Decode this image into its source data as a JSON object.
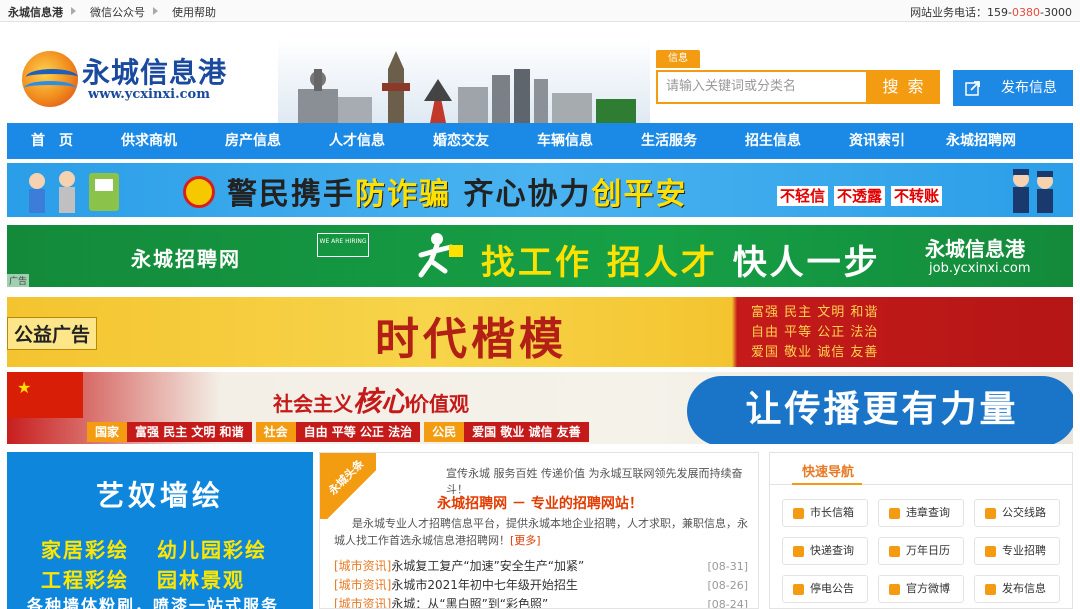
{
  "topbar": {
    "links": [
      "永城信息港",
      "微信公众号",
      "使用帮助"
    ],
    "phone_prefix": "网站业务电话：159-",
    "phone_mid": "0380",
    "phone_suffix": "-3000"
  },
  "logo": {
    "cn": "永城信息港",
    "en": "www.ycxinxi.com"
  },
  "search": {
    "tag": "信息",
    "placeholder": "请输入关键词或分类名",
    "button": "搜 索"
  },
  "publish": {
    "label": "发布信息"
  },
  "nav": [
    "首　页",
    "供求商机",
    "房产信息",
    "人才信息",
    "婚恋交友",
    "车辆信息",
    "生活服务",
    "招生信息",
    "资讯索引",
    "永城招聘网"
  ],
  "banner1": {
    "text_a": "警民携手",
    "text_b": "防诈骗",
    "text_c": "齐心协力",
    "text_d": "创平安",
    "tags": [
      "不轻信",
      "不透露",
      "不转账"
    ]
  },
  "banner2": {
    "left": "永城招聘网",
    "hiring": "WE ARE HIRING",
    "slogan_a": "找工作 招人才",
    "slogan_b": "快人一步",
    "brand": "永城信息港",
    "url": "job.ycxinxi.com",
    "ad": "广告"
  },
  "banner3": {
    "tag": "公益广告",
    "big": "时代楷模",
    "values": [
      "富强 民主 文明 和谐",
      "自由 平等 公正 法治",
      "爱国 敬业 诚信 友善"
    ]
  },
  "banner4": {
    "title_a": "社会主义",
    "title_b": "核心",
    "title_c": "价值观",
    "strip": [
      {
        "k": "国家",
        "v": "富强 民主 文明 和谐"
      },
      {
        "k": "社会",
        "v": "自由 平等 公正 法治"
      },
      {
        "k": "公民",
        "v": "爱国 敬业 诚信 友善"
      }
    ],
    "pill": "让传播更有力量"
  },
  "painting": {
    "title": "艺奴墙绘",
    "row1": [
      "家居彩绘",
      "幼儿园彩绘"
    ],
    "row2": [
      "工程彩绘",
      "园林景观"
    ],
    "row3": "各种墙体粉刷，喷漆一站式服务"
  },
  "news": {
    "ribbon": "永城头条",
    "slogan": "宣传永城 服务百姓 传递价值 为永城互联网领先发展而持续奋斗！",
    "headline": "永城招聘网 － 专业的招聘网站！",
    "desc": "是永城专业人才招聘信息平台，提供永城本地企业招聘，人才求职，兼职信息，永城人找工作首选永城信息港招聘网！",
    "more": "[更多]",
    "items": [
      {
        "cat": "[城市资讯]",
        "title": "永城复工复产“加速”安全生产“加紧”",
        "date": "[08-31]"
      },
      {
        "cat": "[城市资讯]",
        "title": "永城市2021年初中七年级开始招生",
        "date": "[08-26]"
      },
      {
        "cat": "[城市资讯]",
        "title": "永城：从“黑白照”到“彩色照”",
        "date": "[08-24]"
      }
    ]
  },
  "quick": {
    "title": "快速导航",
    "items": [
      "市长信箱",
      "违章查询",
      "公交线路",
      "快递查询",
      "万年日历",
      "专业招聘",
      "停电公告",
      "官方微博",
      "发布信息"
    ]
  },
  "colors": {
    "accent": "#f39c12",
    "nav": "#1a8ae6",
    "link_red": "#e23c00"
  }
}
